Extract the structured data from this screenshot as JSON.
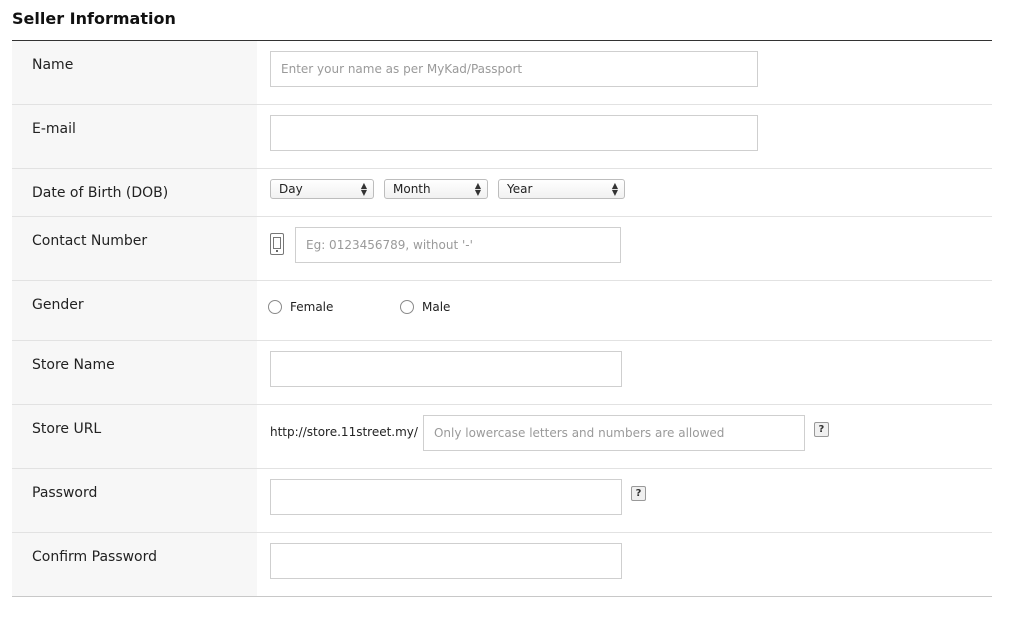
{
  "section": {
    "title": "Seller Information"
  },
  "name": {
    "label": "Name",
    "placeholder": "Enter your name as per MyKad/Passport",
    "value": ""
  },
  "email": {
    "label": "E-mail",
    "placeholder": "",
    "value": ""
  },
  "dob": {
    "label": "Date of Birth (DOB)",
    "day": "Day",
    "month": "Month",
    "year": "Year"
  },
  "contact": {
    "label": "Contact Number",
    "icon": "mobile-phone-icon",
    "placeholder": "Eg: 0123456789, without '-'",
    "value": ""
  },
  "gender": {
    "label": "Gender",
    "options": [
      "Female",
      "Male"
    ]
  },
  "store_name": {
    "label": "Store Name",
    "value": ""
  },
  "store_url": {
    "label": "Store URL",
    "prefix": "http://store.11street.my/",
    "placeholder": "Only lowercase letters and numbers are allowed",
    "help": "?"
  },
  "password": {
    "label": "Password",
    "help": "?"
  },
  "confirm_password": {
    "label": "Confirm Password"
  }
}
